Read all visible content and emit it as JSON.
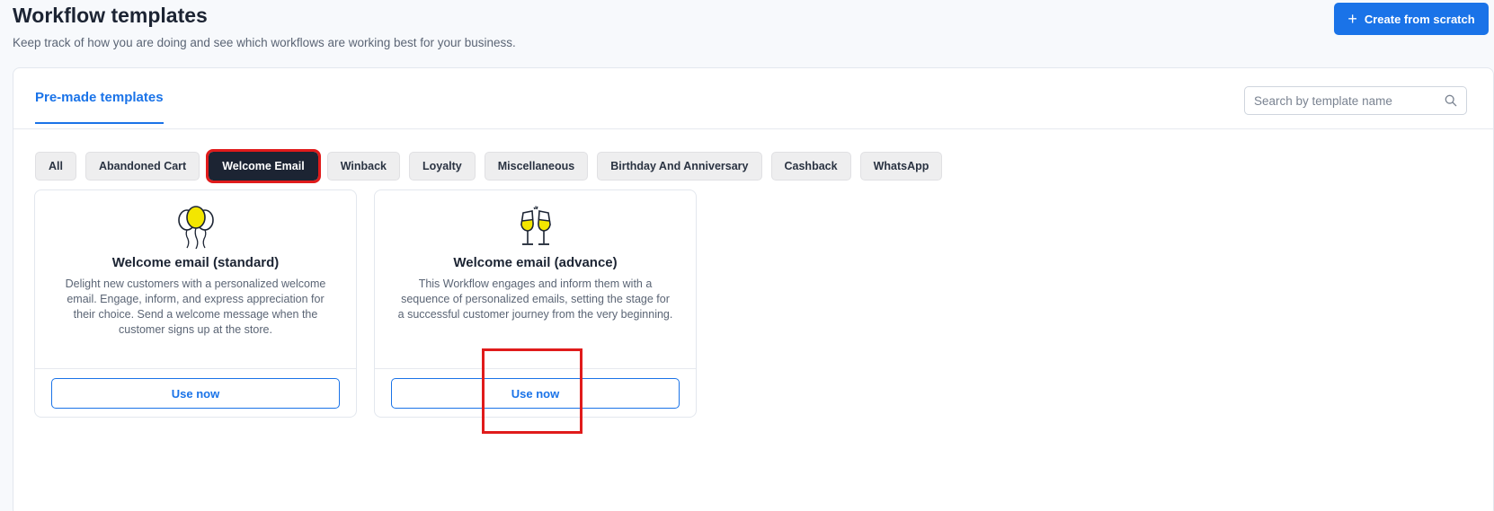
{
  "header": {
    "title": "Workflow templates",
    "subtitle": "Keep track of how you are doing and see which workflows are working best for your business.",
    "create_button": "Create from scratch"
  },
  "tabs": {
    "active": "Pre-made templates"
  },
  "search": {
    "placeholder": "Search by template name",
    "value": ""
  },
  "filters": [
    "All",
    "Abandoned Cart",
    "Welcome Email",
    "Winback",
    "Loyalty",
    "Miscellaneous",
    "Birthday And Anniversary",
    "Cashback",
    "WhatsApp"
  ],
  "active_filter": "Welcome Email",
  "cards": [
    {
      "icon": "balloons-icon",
      "title": "Welcome email (standard)",
      "description": "Delight new customers with a personalized welcome email. Engage, inform, and express appreciation for their choice. Send a welcome message when the customer signs up at the store.",
      "button": "Use now"
    },
    {
      "icon": "champagne-glasses-icon",
      "title": "Welcome email (advance)",
      "description": "This Workflow engages and inform them with a sequence of personalized emails, setting the stage for a successful customer journey from the very beginning.",
      "button": "Use now"
    }
  ],
  "colors": {
    "accent": "#1a73e8",
    "active_chip": "#1c2433",
    "annotation": "#e01b1b",
    "icon_fill": "#f3e600"
  }
}
